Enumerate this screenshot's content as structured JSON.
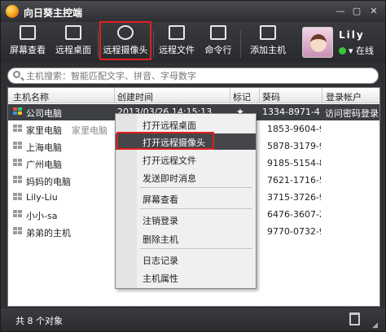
{
  "window": {
    "title": "向日葵主控端",
    "controls": [
      "—",
      "▢",
      "✕"
    ]
  },
  "toolbar": {
    "buttons": [
      {
        "label": "屏幕查看",
        "icon": "screen-view-icon"
      },
      {
        "label": "远程桌面",
        "icon": "remote-desktop-icon"
      },
      {
        "label": "远程摄像头",
        "icon": "webcam-icon"
      },
      {
        "label": "远程文件",
        "icon": "remote-file-icon"
      },
      {
        "label": "命令行",
        "icon": "terminal-icon"
      },
      {
        "label": "添加主机",
        "icon": "add-host-icon"
      }
    ]
  },
  "user": {
    "name": "Lily",
    "status": "在线",
    "status_color": "#37c837"
  },
  "search": {
    "placeholder": "主机搜索：智能匹配文字、拼音、字母数字"
  },
  "columns": [
    "主机名称",
    "创建时间",
    "标记",
    "葵码",
    "登录帐户"
  ],
  "rows": [
    {
      "name": "公司电脑",
      "alias": "",
      "time": "2013/03/26 14:15:13",
      "mark": "★",
      "code": "1334-8971-4",
      "account": "访问密码登录",
      "selected": true,
      "online": true
    },
    {
      "name": "家里电脑",
      "alias": "家里电脑",
      "time": "",
      "mark": "",
      "code": "1853-9604-9",
      "account": "",
      "selected": false,
      "online": false
    },
    {
      "name": "上海电脑",
      "alias": "",
      "time": "",
      "mark": "",
      "code": "5878-3179-9",
      "account": "",
      "selected": false,
      "online": false
    },
    {
      "name": "广州电脑",
      "alias": "",
      "time": "",
      "mark": "",
      "code": "9185-5154-8",
      "account": "",
      "selected": false,
      "online": false
    },
    {
      "name": "妈妈的电脑",
      "alias": "",
      "time": "",
      "mark": "",
      "code": "7621-1716-5",
      "account": "",
      "selected": false,
      "online": false
    },
    {
      "name": "Lily-Liu",
      "alias": "",
      "time": "",
      "mark": "",
      "code": "3715-3726-9",
      "account": "",
      "selected": false,
      "online": false
    },
    {
      "name": "小小-sa",
      "alias": "",
      "time": "",
      "mark": "",
      "code": "6476-3607-2",
      "account": "",
      "selected": false,
      "online": false
    },
    {
      "name": "弟弟的主机",
      "alias": "",
      "time": "",
      "mark": "",
      "code": "9770-0732-9",
      "account": "",
      "selected": false,
      "online": false
    }
  ],
  "context_menu": {
    "items": [
      "打开远程桌面",
      "打开远程摄像头",
      "打开远程文件",
      "发送即时消息",
      "屏幕查看",
      "注销登录",
      "删除主机",
      "日志记录",
      "主机属性"
    ],
    "highlighted_index": 1
  },
  "status": {
    "text": "共 8 个对象"
  },
  "colors": {
    "highlight_border": "#e02020",
    "selection": "#3d3f44",
    "toolbar": "#2f3033"
  }
}
